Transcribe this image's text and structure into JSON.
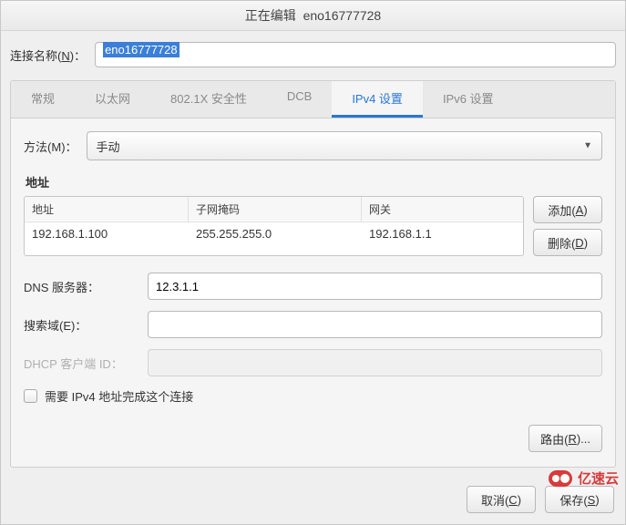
{
  "title": {
    "prefix": "正在编辑",
    "name": "eno16777728"
  },
  "connection_name": {
    "label_pre": "连接名称(",
    "label_key": "N",
    "label_post": ")：",
    "value": "eno16777728"
  },
  "tabs": [
    {
      "label": "常规"
    },
    {
      "label": "以太网"
    },
    {
      "label": "802.1X 安全性"
    },
    {
      "label": "DCB"
    },
    {
      "label": "IPv4 设置",
      "active": true
    },
    {
      "label": "IPv6 设置"
    }
  ],
  "method": {
    "label_pre": "方法(",
    "label_key": "M",
    "label_post": ")：",
    "value": "手动"
  },
  "addresses": {
    "section_title": "地址",
    "headers": {
      "addr": "地址",
      "mask": "子网掩码",
      "gw": "网关"
    },
    "rows": [
      {
        "addr": "192.168.1.100",
        "mask": "255.255.255.0",
        "gw": "192.168.1.1"
      }
    ],
    "add_btn": {
      "pre": "添加(",
      "key": "A",
      "post": ")"
    },
    "del_btn": {
      "pre": "删除(",
      "key": "D",
      "post": ")"
    }
  },
  "dns": {
    "label_pre": "",
    "label_key": "D",
    "label_mid": "NS 服务器：",
    "value": "12.3.1.1"
  },
  "search": {
    "label_pre": "搜索域(",
    "label_key": "E",
    "label_post": ")：",
    "value": ""
  },
  "dhcp": {
    "label": "DHCP 客户端 ID：",
    "value": ""
  },
  "require_ipv4": {
    "label": "需要 IPv4 地址完成这个连接",
    "checked": false
  },
  "routes_btn": {
    "pre": "路由(",
    "key": "R",
    "post": ")..."
  },
  "footer": {
    "cancel": {
      "pre": "取消(",
      "key": "C",
      "post": ")"
    },
    "save": {
      "pre": "保存(",
      "key": "S",
      "post": ")"
    }
  },
  "watermark": "亿速云"
}
